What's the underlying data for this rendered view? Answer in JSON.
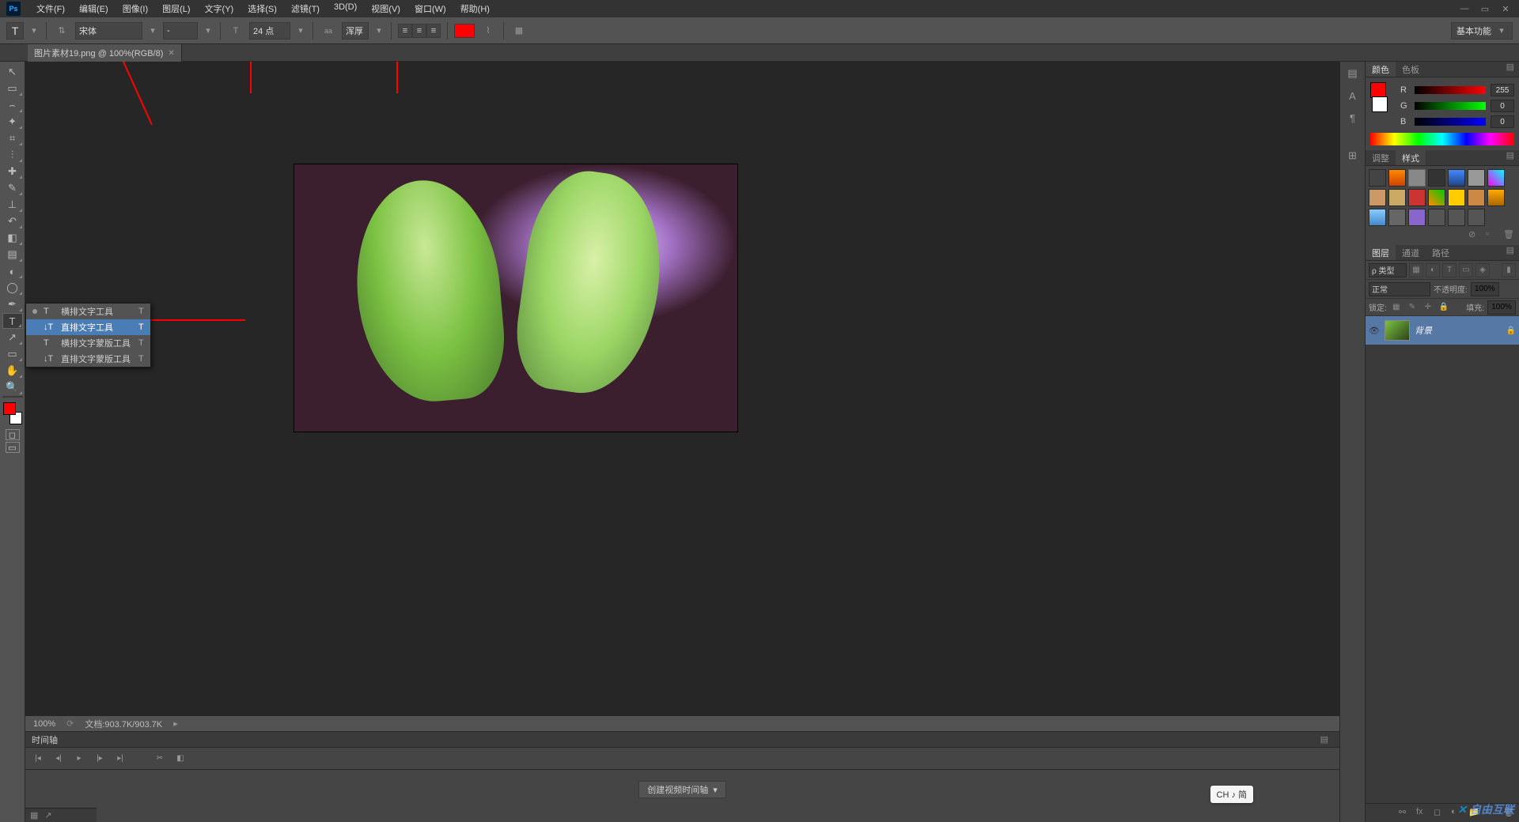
{
  "menu": {
    "file": "文件(F)",
    "edit": "编辑(E)",
    "image": "图像(I)",
    "layer": "图层(L)",
    "type": "文字(Y)",
    "select": "选择(S)",
    "filter": "滤镜(T)",
    "3d": "3D(D)",
    "view": "视图(V)",
    "window": "窗口(W)",
    "help": "帮助(H)"
  },
  "options": {
    "font": "宋体",
    "style": "-",
    "size_icon": "T",
    "size": "24 点",
    "aa_label": "aa",
    "aa": "浑厚",
    "workspace": "基本功能"
  },
  "doc_tab": {
    "title": "图片素材19.png @ 100%(RGB/8)"
  },
  "text_flyout": {
    "items": [
      {
        "label": "横排文字工具",
        "key": "T"
      },
      {
        "label": "直排文字工具",
        "key": "T"
      },
      {
        "label": "横排文字蒙版工具",
        "key": "T"
      },
      {
        "label": "直排文字蒙版工具",
        "key": "T"
      }
    ]
  },
  "status": {
    "zoom": "100%",
    "doc_info": "文档:903.7K/903.7K"
  },
  "timeline": {
    "title": "时间轴",
    "create_btn": "创建视频时间轴"
  },
  "color_panel": {
    "tab_color": "颜色",
    "tab_swatch": "色板",
    "r_label": "R",
    "g_label": "G",
    "b_label": "B",
    "r_val": "255",
    "g_val": "0",
    "b_val": "0"
  },
  "styles_panel": {
    "tab_adjust": "调整",
    "tab_styles": "样式"
  },
  "layers_panel": {
    "tab_layers": "图层",
    "tab_channels": "通道",
    "tab_paths": "路径",
    "filter_label": "ρ 类型",
    "blend": "正常",
    "opacity_label": "不透明度:",
    "opacity": "100%",
    "lock_label": "锁定:",
    "fill_label": "填充:",
    "fill": "100%",
    "layer_name": "背景"
  },
  "ime": "CH ♪ 简",
  "watermark": "自由互联"
}
